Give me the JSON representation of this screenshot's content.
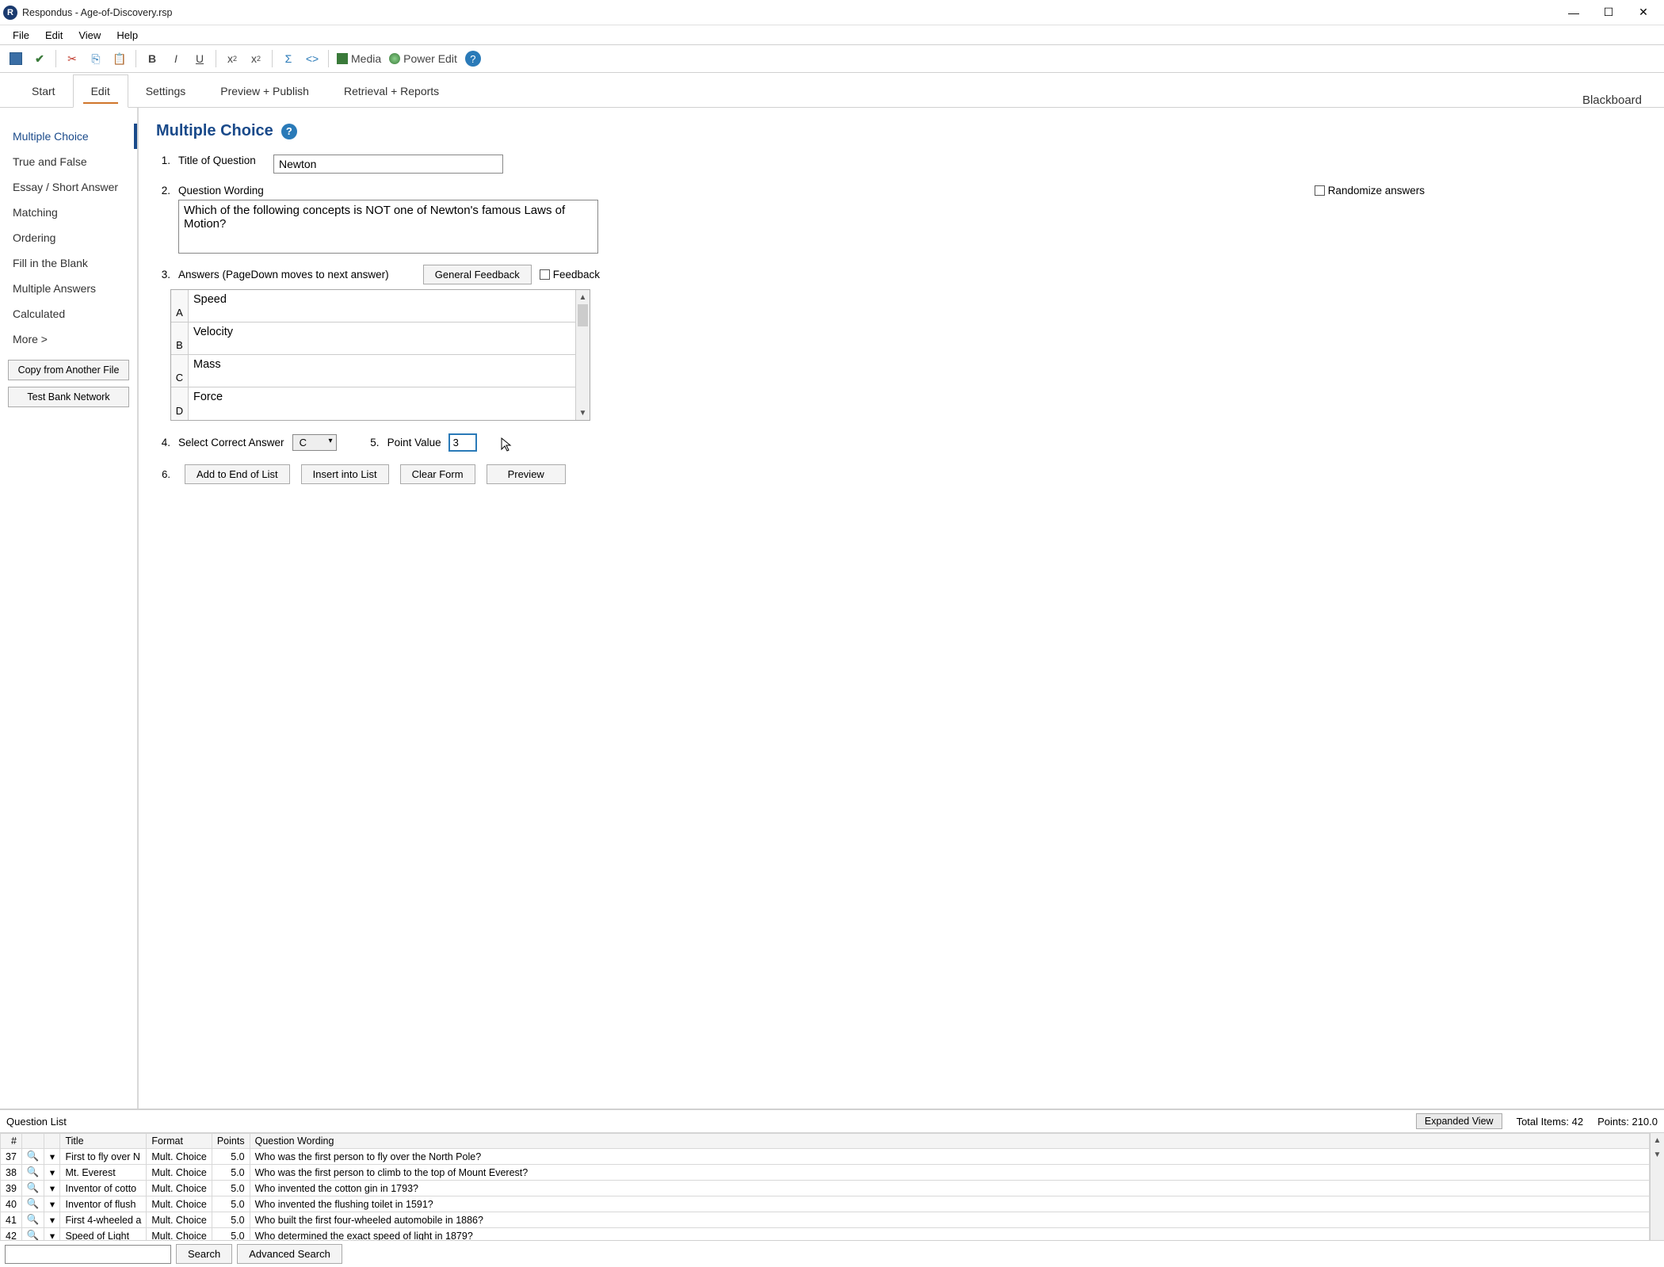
{
  "window": {
    "title": "Respondus - Age-of-Discovery.rsp",
    "app_initial": "R"
  },
  "menu": {
    "items": [
      "File",
      "Edit",
      "View",
      "Help"
    ]
  },
  "toolbar": {
    "media": "Media",
    "power_edit": "Power Edit"
  },
  "tabs": {
    "items": [
      "Start",
      "Edit",
      "Settings",
      "Preview + Publish",
      "Retrieval + Reports"
    ],
    "active": "Edit",
    "lms": "Blackboard"
  },
  "sidebar": {
    "items": [
      "Multiple Choice",
      "True and False",
      "Essay / Short Answer",
      "Matching",
      "Ordering",
      "Fill in the Blank",
      "Multiple Answers",
      "Calculated",
      "More >"
    ],
    "copy_btn": "Copy from Another File",
    "tbn_btn": "Test Bank Network"
  },
  "page": {
    "heading": "Multiple Choice",
    "row1_label": "Title of Question",
    "title_value": "Newton",
    "row2_label": "Question Wording",
    "randomize_label": "Randomize answers",
    "wording_value": "Which of the following concepts is NOT one of Newton's famous Laws of Motion?",
    "row3_label": "Answers  (PageDown moves to next answer)",
    "general_feedback_btn": "General Feedback",
    "feedback_label": "Feedback",
    "answers": [
      {
        "letter": "A",
        "text": "Speed"
      },
      {
        "letter": "B",
        "text": "Velocity"
      },
      {
        "letter": "C",
        "text": "Mass"
      },
      {
        "letter": "D",
        "text": "Force"
      }
    ],
    "row4_label": "Select Correct Answer",
    "correct_value": "C",
    "row5_label": "Point Value",
    "point_value": "3",
    "add_btn": "Add to End of List",
    "insert_btn": "Insert into List",
    "clear_btn": "Clear Form",
    "preview_btn": "Preview"
  },
  "qlist": {
    "label": "Question List",
    "expanded_btn": "Expanded View",
    "total_items": "Total Items: 42",
    "points": "Points: 210.0",
    "headers": {
      "num": "#",
      "title": "Title",
      "format": "Format",
      "points": "Points",
      "wording": "Question Wording"
    },
    "rows": [
      {
        "n": "37",
        "title": "First to fly over N",
        "format": "Mult. Choice",
        "points": "5.0",
        "wording": "Who was the first person to fly over the North Pole?"
      },
      {
        "n": "38",
        "title": "Mt. Everest",
        "format": "Mult. Choice",
        "points": "5.0",
        "wording": "Who was the first person to climb to the top of Mount Everest?"
      },
      {
        "n": "39",
        "title": "Inventor of cotto",
        "format": "Mult. Choice",
        "points": "5.0",
        "wording": "Who invented the cotton gin in 1793?"
      },
      {
        "n": "40",
        "title": "Inventor of flush",
        "format": "Mult. Choice",
        "points": "5.0",
        "wording": "Who invented the flushing toilet in 1591?"
      },
      {
        "n": "41",
        "title": "First 4-wheeled a",
        "format": "Mult. Choice",
        "points": "5.0",
        "wording": "Who built the first four-wheeled automobile in 1886?"
      },
      {
        "n": "42",
        "title": "Speed of Light",
        "format": "Mult. Choice",
        "points": "5.0",
        "wording": "Who determined the exact speed of light in 1879?"
      }
    ],
    "search_btn": "Search",
    "adv_search_btn": "Advanced Search"
  }
}
